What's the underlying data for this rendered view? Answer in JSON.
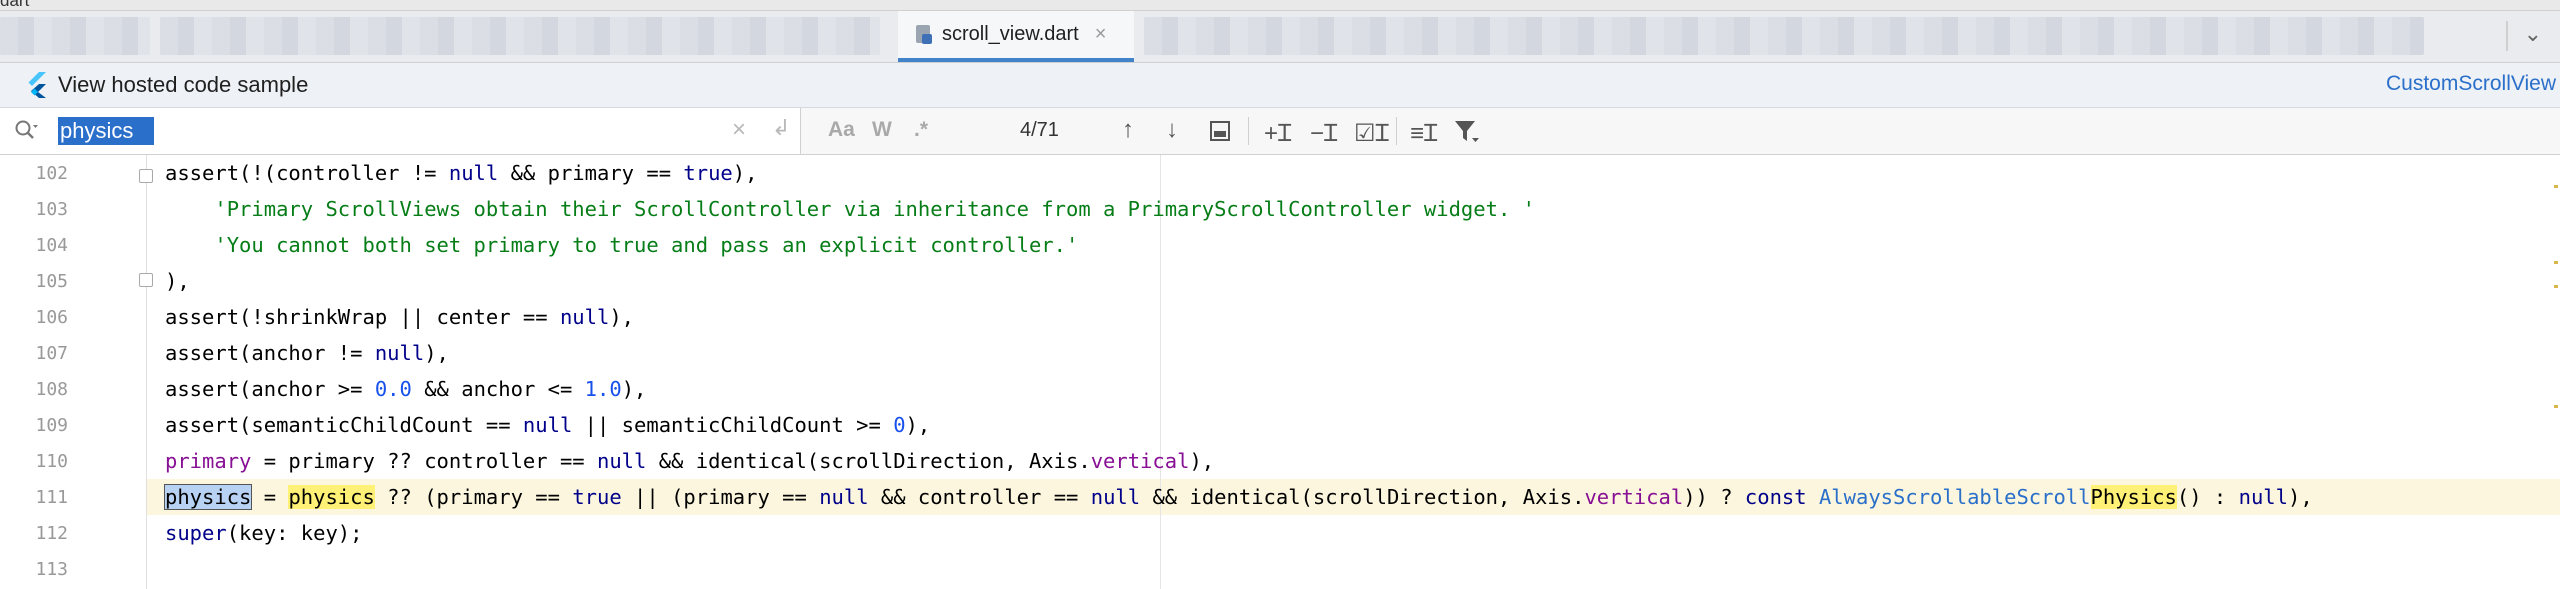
{
  "window": {
    "top_label": "dart"
  },
  "tabs": [
    {
      "label": "scroll_view.dart",
      "close": "×",
      "active": true
    }
  ],
  "banner": {
    "text": "View hosted code sample",
    "link": "CustomScrollView"
  },
  "find": {
    "query": "physics",
    "clear": "×",
    "enter": "↲",
    "opt_case": "Aa",
    "opt_word": "W",
    "opt_regex": ".*",
    "count": "4/71"
  },
  "editor": {
    "lines": [
      {
        "num": "102",
        "tokens": [
          [
            "",
            "assert(!(controller != "
          ],
          [
            "k",
            "null"
          ],
          [
            "",
            " && primary == "
          ],
          [
            "k",
            "true"
          ],
          [
            "",
            "),"
          ]
        ]
      },
      {
        "num": "103",
        "tokens": [
          [
            "",
            "    "
          ],
          [
            "str",
            "'Primary ScrollViews obtain their ScrollController via inheritance from a PrimaryScrollController widget. '"
          ]
        ]
      },
      {
        "num": "104",
        "tokens": [
          [
            "",
            "    "
          ],
          [
            "str",
            "'You cannot both set primary to true and pass an explicit controller.'"
          ]
        ]
      },
      {
        "num": "105",
        "tokens": [
          [
            "",
            "),"
          ]
        ]
      },
      {
        "num": "106",
        "tokens": [
          [
            "",
            "assert(!shrinkWrap || center == "
          ],
          [
            "k",
            "null"
          ],
          [
            "",
            "),"
          ]
        ]
      },
      {
        "num": "107",
        "tokens": [
          [
            "",
            "assert(anchor != "
          ],
          [
            "k",
            "null"
          ],
          [
            "",
            "),"
          ]
        ]
      },
      {
        "num": "108",
        "tokens": [
          [
            "",
            "assert(anchor >= "
          ],
          [
            "num",
            "0.0"
          ],
          [
            "",
            " && anchor <= "
          ],
          [
            "num",
            "1.0"
          ],
          [
            "",
            "),"
          ]
        ]
      },
      {
        "num": "109",
        "tokens": [
          [
            "",
            "assert(semanticChildCount == "
          ],
          [
            "k",
            "null"
          ],
          [
            "",
            " || semanticChildCount >= "
          ],
          [
            "num",
            "0"
          ],
          [
            "",
            "),"
          ]
        ]
      },
      {
        "num": "110",
        "tokens": [
          [
            "prop",
            "primary"
          ],
          [
            "",
            " = primary ?? controller == "
          ],
          [
            "k",
            "null"
          ],
          [
            "",
            " && identical(scrollDirection, Axis."
          ],
          [
            "prop",
            "vertical"
          ],
          [
            "",
            "),"
          ]
        ]
      },
      {
        "num": "111",
        "current": true,
        "tokens": [
          [
            "hl-sel",
            "physics"
          ],
          [
            "",
            " = "
          ],
          [
            "hl",
            "physics"
          ],
          [
            "",
            " ?? (primary == "
          ],
          [
            "k",
            "true"
          ],
          [
            "",
            " || (primary == "
          ],
          [
            "k",
            "null"
          ],
          [
            "",
            " && controller == "
          ],
          [
            "k",
            "null"
          ],
          [
            "",
            " && identical(scrollDirection, Axis."
          ],
          [
            "prop",
            "vertical"
          ],
          [
            "",
            ")) ? "
          ],
          [
            "k",
            "const "
          ],
          [
            "cls",
            "AlwaysScrollableScroll"
          ],
          [
            "hl",
            "Physics"
          ],
          [
            "",
            "() : "
          ],
          [
            "k",
            "null"
          ],
          [
            "",
            "),"
          ]
        ]
      },
      {
        "num": "112",
        "tokens": [
          [
            "k",
            "super"
          ],
          [
            "",
            "(key: key);"
          ]
        ]
      },
      {
        "num": "113",
        "tokens": []
      }
    ]
  }
}
